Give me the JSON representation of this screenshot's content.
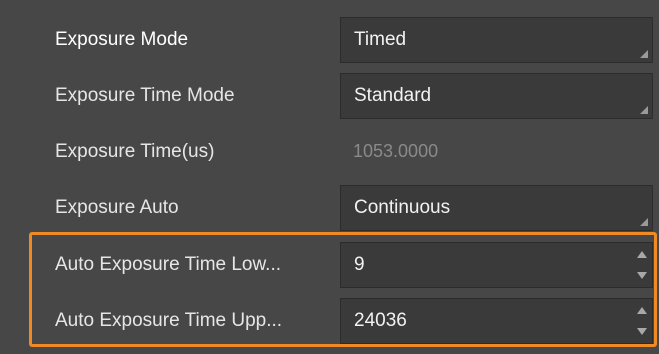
{
  "properties": [
    {
      "label": "Exposure Mode",
      "value": "Timed",
      "control": "dropdown",
      "enabled": true
    },
    {
      "label": "Exposure Time Mode",
      "value": "Standard",
      "control": "dropdown",
      "enabled": true
    },
    {
      "label": "Exposure Time(us)",
      "value": "1053.0000",
      "control": "text",
      "enabled": false
    },
    {
      "label": "Exposure Auto",
      "value": "Continuous",
      "control": "dropdown",
      "enabled": true
    },
    {
      "label": "Auto Exposure Time Low...",
      "value": "9",
      "control": "spinbox",
      "enabled": true
    },
    {
      "label": "Auto Exposure Time Upp...",
      "value": "24036",
      "control": "spinbox",
      "enabled": true
    }
  ],
  "colors": {
    "background": "#474747",
    "field": "#3a3a3a",
    "highlight": "#f08a24",
    "disabled_text": "#8a8a8a"
  }
}
